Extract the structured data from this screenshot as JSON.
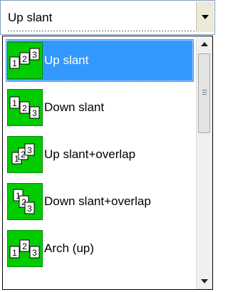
{
  "combo": {
    "value": "Up slant",
    "icon": "chevron-down-icon"
  },
  "dropdown": {
    "items": [
      {
        "label": "Up slant",
        "icon": "up-slant-icon",
        "selected": true
      },
      {
        "label": "Down slant",
        "icon": "down-slant-icon",
        "selected": false
      },
      {
        "label": "Up slant+overlap",
        "icon": "up-slant-overlap-icon",
        "selected": false
      },
      {
        "label": "Down slant+overlap",
        "icon": "down-slant-overlap-icon",
        "selected": false
      },
      {
        "label": "Arch (up)",
        "icon": "arch-up-icon",
        "selected": false
      }
    ]
  },
  "colors": {
    "selection": "#3399ff",
    "tile": "#00cc00"
  }
}
